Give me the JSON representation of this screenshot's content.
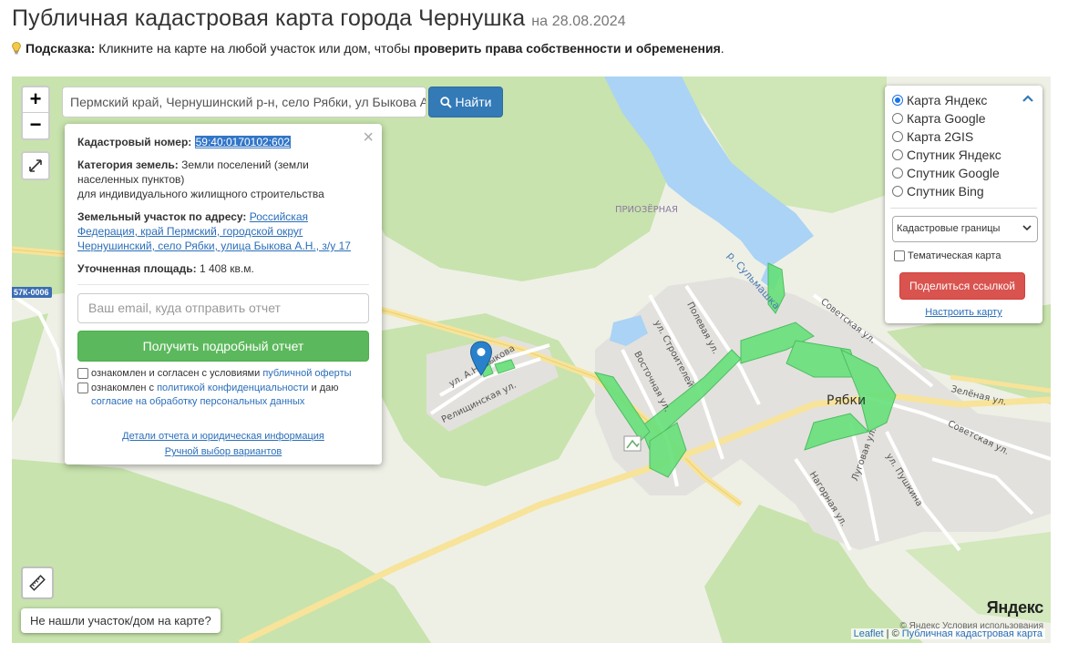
{
  "header": {
    "title": "Публичная кадастровая карта города Чернушка",
    "date": "на 28.08.2024"
  },
  "hint": {
    "label": "Подсказка:",
    "text": "Кликните на карте на любой участок или дом, чтобы",
    "bold_text": "проверить права собственности и обременения",
    "tail": "."
  },
  "search": {
    "value": "Пермский край, Чернушинский р-н, село Рябки, ул Быкова А.Н.",
    "button_label": "Найти"
  },
  "zoom": {
    "in": "+",
    "out": "−"
  },
  "popup": {
    "cad_label": "Кадастровый номер:",
    "cad_value": "59:40:0170102:602",
    "category_label": "Категория земель:",
    "category_value": "Земли поселений (земли населенных пунктов)",
    "category_use": "для индивидуального жилищного строительства",
    "address_label": "Земельный участок по адресу:",
    "address_value": "Российская Федерация, край Пермский, городской округ Чернушинский, село Рябки, улица Быкова А.Н., з/у 17",
    "area_label": "Уточненная площадь:",
    "area_value": "1 408 кв.м.",
    "email_placeholder": "Ваш email, куда отправить отчет",
    "report_button": "Получить подробный отчет",
    "agree1_text": "ознакомлен и согласен с условиями",
    "agree1_link": "публичной оферты",
    "agree2_text": "ознакомлен с",
    "agree2_link": "политикой конфиденциальности",
    "agree2_mid": "и даю",
    "agree2_link2": "согласие на обработку персональных данных",
    "details_link": "Детали отчета и юридическая информация",
    "manual_link": "Ручной выбор вариантов"
  },
  "layers": {
    "options": [
      {
        "label": "Карта Яндекс",
        "checked": true
      },
      {
        "label": "Карта Google",
        "checked": false
      },
      {
        "label": "Карта 2GIS",
        "checked": false
      },
      {
        "label": "Спутник Яндекс",
        "checked": false
      },
      {
        "label": "Спутник Google",
        "checked": false
      },
      {
        "label": "Спутник Bing",
        "checked": false
      }
    ],
    "select_value": "Кадастровые границы",
    "thematic_label": "Тематическая карта",
    "share_button": "Поделиться ссылкой",
    "config_link": "Настроить карту"
  },
  "map_labels": {
    "lake_area": "ПРИОЗЁРНАЯ",
    "river": "р. Сульмашка",
    "village": "Рябки",
    "road_badge": "57К-0006",
    "streets": {
      "bykova": "ул. А.Н. Быкова",
      "relishchinskaya": "Релищинская ул.",
      "polevaya": "Полевая ул.",
      "stroiteley": "ул. Строителей",
      "vostochnaya": "Восточная ул.",
      "sovetskaya1": "Советская ул.",
      "sovetskaya2": "Советская ул.",
      "zelenaya": "Зелёная ул.",
      "lugovaya": "Луговая ул.",
      "pushkina": "ул. Пушкина",
      "nagornaya": "Нагорная ул."
    }
  },
  "not_found_button": "Не нашли участок/дом на карте?",
  "attribution": {
    "leaflet": "Leaflet",
    "sep": " | © ",
    "source": "Публичная кадастровая карта",
    "yandex_logo": "Яндекс",
    "yandex_terms": "© Яндекс Условия использования"
  },
  "colors": {
    "primary": "#337ab7",
    "success": "#5cb85c",
    "danger": "#d9534f",
    "water": "#aad3f5",
    "forest": "#c4e0a8",
    "cadastre_green": "#4cd964",
    "road_yellow": "#f7e39a"
  }
}
